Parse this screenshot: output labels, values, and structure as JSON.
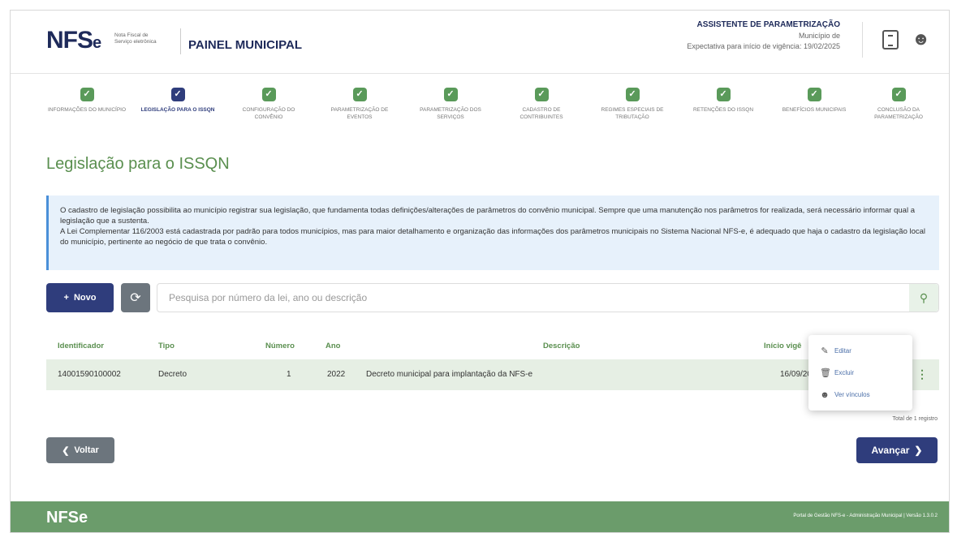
{
  "header": {
    "logo_text": "NFS",
    "logo_e": "e",
    "logo_sub": "Nota Fiscal de Serviço eletrônica",
    "painel": "PAINEL MUNICIPAL",
    "assist_title": "ASSISTENTE DE PARAMETRIZAÇÃO",
    "municipio": "Município de",
    "vigencia": "Expectativa para início de vigência: 19/02/2025"
  },
  "steps": [
    {
      "label": "INFORMAÇÕES DO MUNICÍPIO"
    },
    {
      "label": "LEGISLAÇÃO PARA O ISSQN"
    },
    {
      "label": "CONFIGURAÇÃO DO CONVÊNIO"
    },
    {
      "label": "PARAMETRIZAÇÃO DE EVENTOS"
    },
    {
      "label": "PARAMETRIZAÇÃO DOS SERVIÇOS"
    },
    {
      "label": "CADASTRO DE CONTRIBUINTES"
    },
    {
      "label": "REGIMES ESPECIAIS DE TRIBUTAÇÃO"
    },
    {
      "label": "RETENÇÕES DO ISSQN"
    },
    {
      "label": "BENEFÍCIOS MUNICIPAIS"
    },
    {
      "label": "CONCLUSÃO DA PARAMETRIZAÇÃO"
    }
  ],
  "page_title": "Legislação para o ISSQN",
  "info": {
    "line1": "O cadastro de legislação possibilita ao município registrar sua legislação, que fundamenta todas definições/alterações de parâmetros do convênio municipal. Sempre que uma manutenção nos parâmetros for realizada, será necessário informar qual a legislação que a sustenta.",
    "line2": "A Lei Complementar 116/2003 está cadastrada por padrão para todos municípios, mas para maior detalhamento e organização das informações dos parâmetros municipais no Sistema Nacional NFS-e, é adequado que haja o cadastro da legislação local do município, pertinente ao negócio de que trata o convênio."
  },
  "toolbar": {
    "novo_label": "Novo",
    "search_placeholder": "Pesquisa por número da lei, ano ou descrição"
  },
  "table": {
    "headers": {
      "id": "Identificador",
      "tipo": "Tipo",
      "numero": "Número",
      "ano": "Ano",
      "descricao": "Descrição",
      "inicio": "Início vigê"
    },
    "row": {
      "id": "14001590100002",
      "tipo": "Decreto",
      "numero": "1",
      "ano": "2022",
      "descricao": "Decreto municipal para implantação da NFS-e",
      "inicio": "16/09/20"
    },
    "total": "Total de 1 registro"
  },
  "dropdown": {
    "editar": "Editar",
    "excluir": "Excluir",
    "vinculos": "Ver vínculos"
  },
  "buttons": {
    "voltar": "Voltar",
    "avancar": "Avançar"
  },
  "footer": {
    "logo": "NFSe",
    "text": "Portal de Gestão NFS-e - Administração Municipal | Versão 1.3.0.2"
  },
  "colors": {
    "primary": "#2f3d7c",
    "green": "#5a8f4f",
    "footer": "#6b9c6b"
  }
}
